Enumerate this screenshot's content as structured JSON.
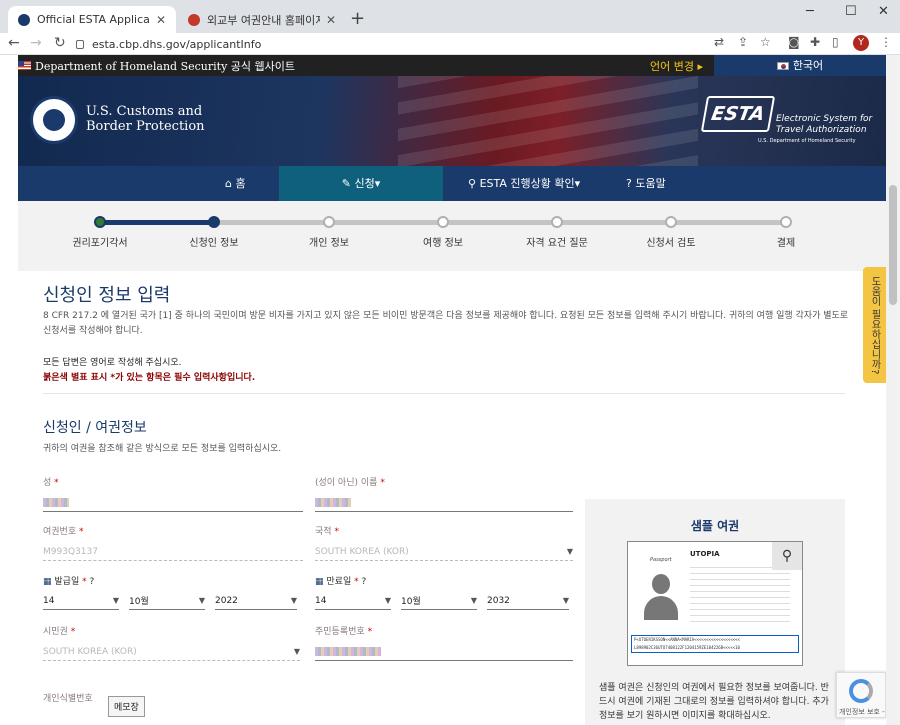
{
  "browser": {
    "tabs": [
      {
        "title": "Official ESTA Application Webs",
        "favicon_color": "#1a3a6b"
      },
      {
        "title": "외교부 여권안내 홈페이지",
        "favicon_color": "#c0392b"
      }
    ],
    "url": "esta.cbp.dhs.gov/applicantInfo",
    "profile_initial": "Y"
  },
  "dhs_bar": {
    "text": "Department of Homeland Security 공식 웹사이트",
    "language_change": "언어 변경",
    "current_language": "한국어"
  },
  "header": {
    "agency_line1": "U.S. Customs and",
    "agency_line2": "Border Protection",
    "esta_logo": "ESTA",
    "esta_line1": "Electronic System for",
    "esta_line2": "Travel Authorization",
    "esta_sub": "U.S. Department of Homeland Security"
  },
  "nav": {
    "home": "홈",
    "apply": "신청",
    "status": "ESTA 진행상황 확인",
    "help": "도움말"
  },
  "progress": {
    "steps": [
      "권리포기각서",
      "신청인 정보",
      "개인 정보",
      "여행 정보",
      "자격 요건 질문",
      "신청서 검토",
      "결제"
    ],
    "current_index": 1
  },
  "main": {
    "title": "신청인 정보 입력",
    "intro": "8 CFR 217.2 에 열거된 국가 [1] 중 하나의 국민이며 방문 비자를 가지고 있지 않은 모든 비이민 방문객은 다음 정보를 제공해야 합니다. 요청된 모든 정보를 입력해 주시기 바랍니다. 귀하의 여행 일행 각자가 별도로 신청서를 작성해야 합니다.",
    "note_english": "모든 답변은 영어로 작성해 주십시오.",
    "note_required": "붉은색 별표 표시 *가 있는 항목은 필수 입력사항입니다.",
    "section_title": "신청인 / 여권정보",
    "section_sub": "귀하의 여권을 참조해 같은 방식으로 모든 정보를 입력하십시오."
  },
  "form": {
    "surname_label": "성",
    "given_name_label": "(성이 아닌) 이름",
    "passport_number_label": "여권번호",
    "passport_number_value": "M993Q3137",
    "nationality_label": "국적",
    "nationality_value": "SOUTH KOREA (KOR)",
    "issue_date_label": "발급일",
    "issue_day": "14",
    "issue_month": "10월",
    "issue_year": "2022",
    "expiry_date_label": "만료일",
    "expiry_day": "14",
    "expiry_month": "10월",
    "expiry_year": "2032",
    "citizenship_label": "시민권",
    "citizenship_value": "SOUTH KOREA (KOR)",
    "resident_number_label": "주민등록번호",
    "personal_id_label": "개인식별번호",
    "required_mark": "*"
  },
  "sample_passport": {
    "title": "샘플 여권",
    "country": "UTOPIA",
    "passport_label": "Passport",
    "mrz_line1": "P<UTOERIKSSON<<ANNA<MARIA<<<<<<<<<<<<<<<<<<<",
    "mrz_line2": "L898902C36UTO7408122F1204159ZE184226B<<<<<10",
    "description": "샘플 여권은 신청인의 여권에서 필요한 정보를 보여줍니다. 반드시 여권에 기재된 그대로의 정보를 입력하셔야 합니다. 추가 정보를 보기 원하시면 이미지를 확대하십시오."
  },
  "side_tab": "도움이 필요하십니까?",
  "memo_tooltip": "메모장",
  "recaptcha_text": "개인정보 보호 - 약관"
}
